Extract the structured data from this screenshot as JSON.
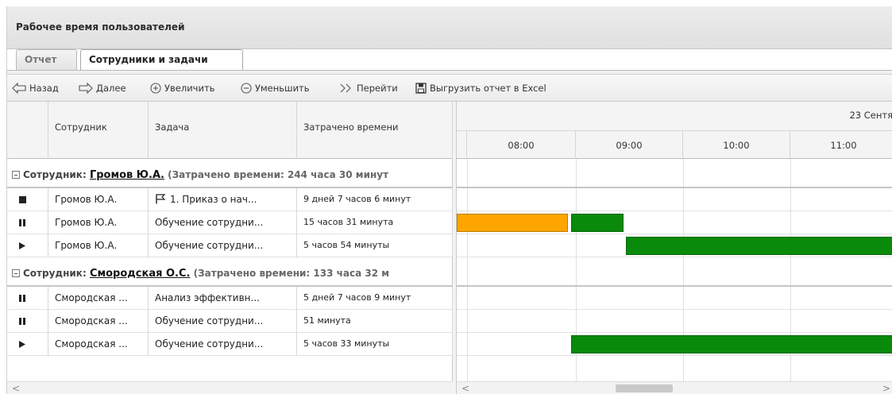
{
  "window": {
    "title": "Рабочее время пользователей"
  },
  "tabs": [
    {
      "label": "Отчет",
      "active": false
    },
    {
      "label": "Сотрудники и задачи",
      "active": true
    }
  ],
  "toolbar": {
    "back": "Назад",
    "forward": "Далее",
    "zoom_in": "Увеличить",
    "zoom_out": "Уменьшить",
    "goto": "Перейти",
    "export": "Выгрузить отчет в Excel"
  },
  "columns": {
    "employee": "Сотрудник",
    "task": "Задача",
    "time_spent": "Затрачено времени"
  },
  "timeline": {
    "date": "23 Сентя",
    "hours": [
      "08:00",
      "09:00",
      "10:00",
      "11:00"
    ]
  },
  "groups": [
    {
      "label": "Сотрудник:",
      "name": "Громов Ю.А.",
      "summary": "(Затрачено времени: 244 часа 30 минут",
      "rows": [
        {
          "status": "stop",
          "employee": "Громов Ю.А.",
          "task": "1. Приказ о нач...",
          "task_flag": true,
          "time": "9 дней 7 часов 6 минут"
        },
        {
          "status": "pause",
          "employee": "Громов Ю.А.",
          "task": "Обучение сотрудни...",
          "task_flag": false,
          "time": "15 часов 31 минута"
        },
        {
          "status": "play",
          "employee": "Громов Ю.А.",
          "task": "Обучение сотрудни...",
          "task_flag": false,
          "time": "5 часов 54 минуты"
        }
      ]
    },
    {
      "label": "Сотрудник:",
      "name": "Смородская О.С.",
      "summary": "(Затрачено времени: 133 часа 32 м",
      "rows": [
        {
          "status": "pause",
          "employee": "Смородская ...",
          "task": "Анализ эффективн...",
          "task_flag": false,
          "time": "5 дней 7 часов 9 минут"
        },
        {
          "status": "pause",
          "employee": "Смородская ...",
          "task": "Обучение сотрудни...",
          "task_flag": false,
          "time": "51 минута"
        },
        {
          "status": "play",
          "employee": "Смородская ...",
          "task": "Обучение сотрудни...",
          "task_flag": false,
          "time": "5 часов 33 минуты"
        }
      ]
    }
  ],
  "colors": {
    "orange": "#FFA500",
    "green": "#0A8A0A",
    "header_bg": "#E6E6E6"
  },
  "scroll": {
    "left_arrow": "<",
    "right_arrow": ">"
  }
}
